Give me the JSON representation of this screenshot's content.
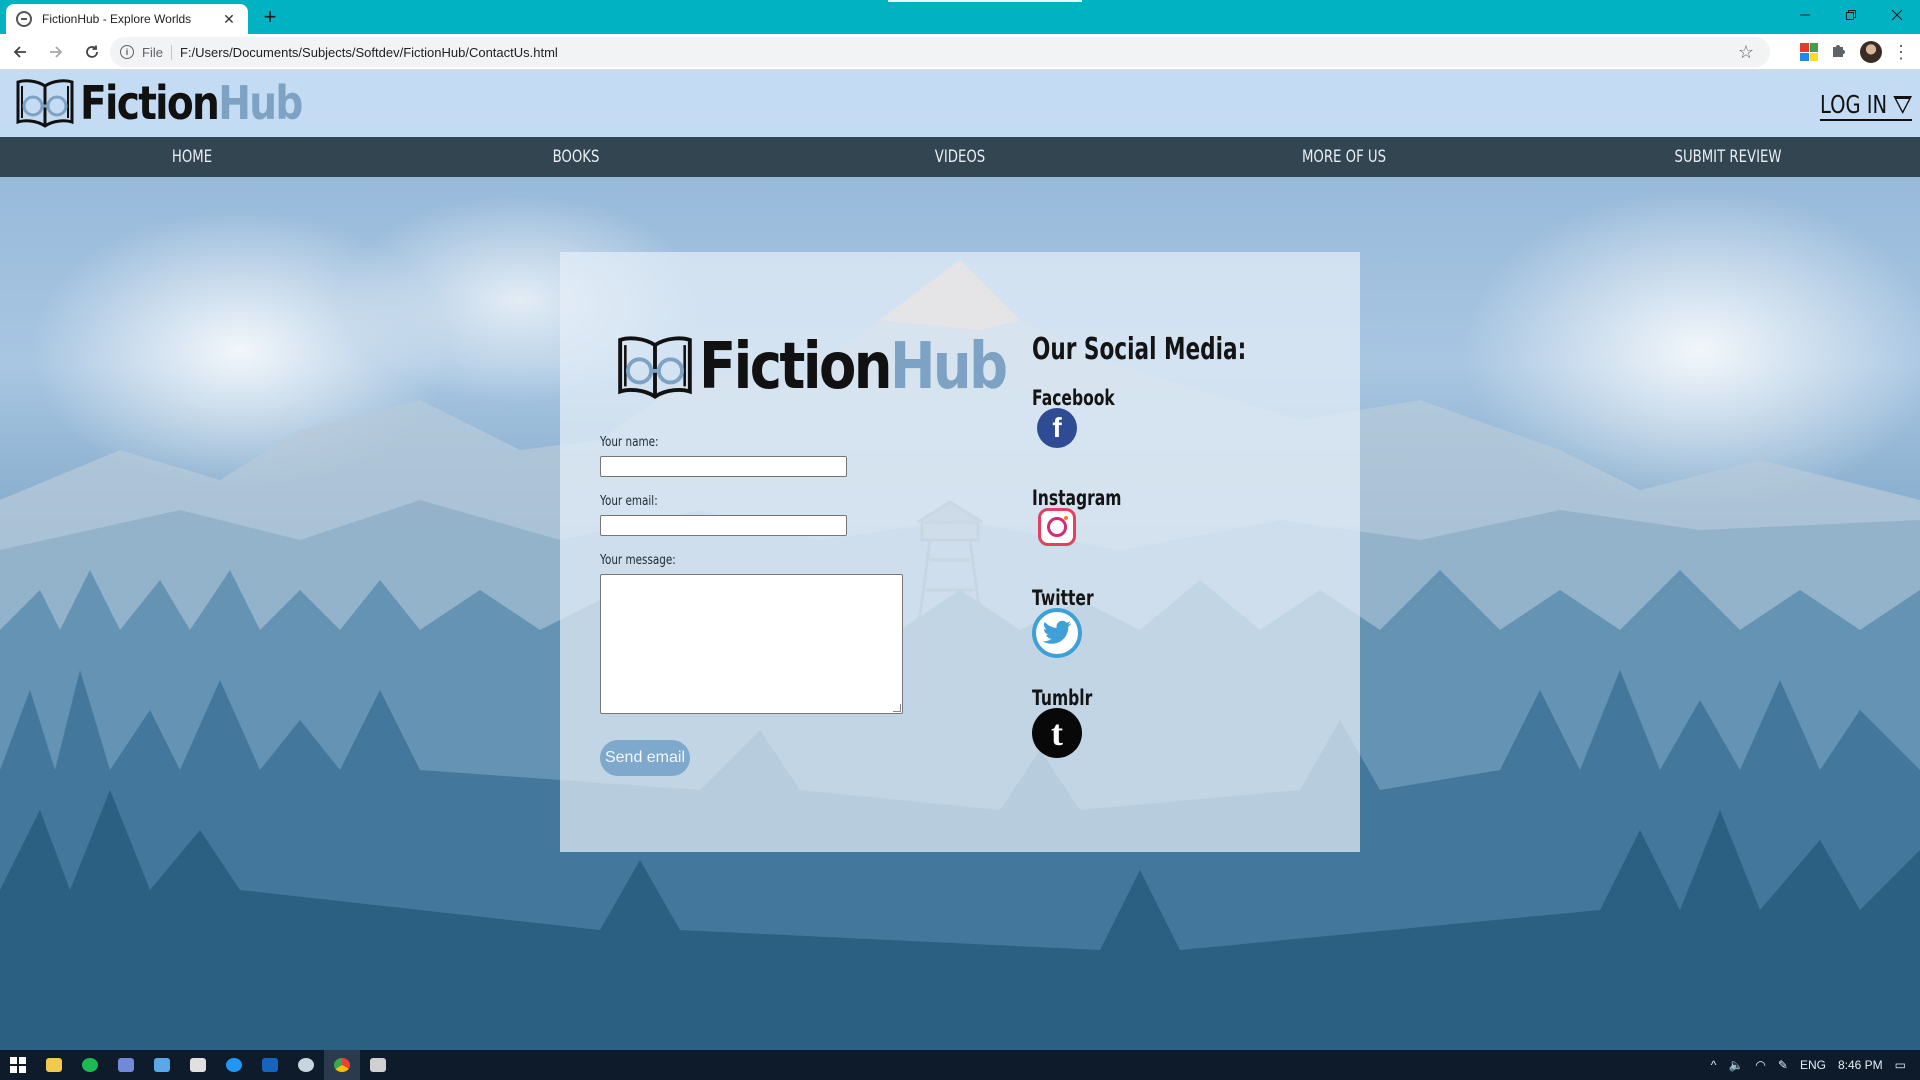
{
  "browser": {
    "tab_title": "FictionHub - Explore Worlds",
    "tab_close": "✕",
    "new_tab": "+",
    "file_label": "File",
    "url": "F:/Users/Documents/Subjects/Softdev/FictionHub/ContactUs.html"
  },
  "site": {
    "logo_fiction": "Fiction",
    "logo_hub": "Hub",
    "login_label": "LOG IN",
    "nav": [
      "HOME",
      "BOOKS",
      "VIDEOS",
      "MORE OF US",
      "SUBMIT REVIEW"
    ]
  },
  "form": {
    "name_label": "Your name:",
    "email_label": "Your email:",
    "message_label": "Your message:",
    "name_value": "",
    "email_value": "",
    "message_value": "",
    "send_label": "Send email"
  },
  "social": {
    "heading": "Our Social Media:",
    "facebook": "Facebook",
    "instagram": "Instagram",
    "twitter": "Twitter",
    "tumblr": "Tumblr",
    "facebook_glyph": "f",
    "tumblr_glyph": "t"
  },
  "taskbar": {
    "language": "ENG",
    "time": "8:46 PM"
  },
  "colors": {
    "browser_accent": "#00b2c2",
    "nav_bar": "#344552",
    "logo_hub": "#7ea2c4",
    "send_button": "#7ea8cc"
  }
}
